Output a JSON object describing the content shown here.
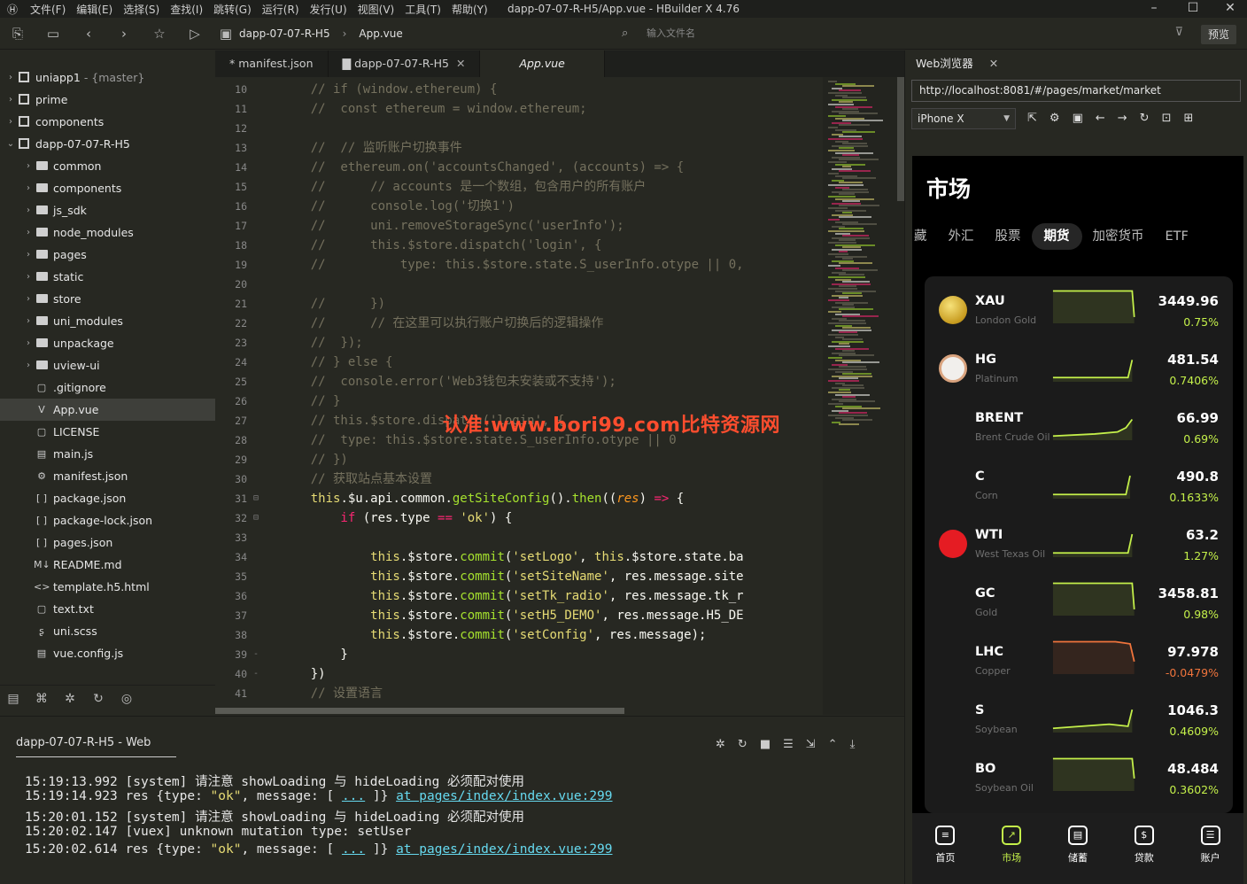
{
  "window": {
    "title": "dapp-07-07-R-H5/App.vue - HBuilder X 4.76",
    "menus": [
      "文件(F)",
      "编辑(E)",
      "选择(S)",
      "查找(I)",
      "跳转(G)",
      "运行(R)",
      "发行(U)",
      "视图(V)",
      "工具(T)",
      "帮助(Y)"
    ]
  },
  "toolbar": {
    "breadcrumb": [
      "dapp-07-07-R-H5",
      "App.vue"
    ],
    "file_input_placeholder": "输入文件名",
    "preview_label": "预览"
  },
  "sidebar": {
    "items": [
      {
        "label": "uniapp1",
        "extra": "- {master}",
        "type": "project",
        "level": 0,
        "chev": "›"
      },
      {
        "label": "prime",
        "extra": "",
        "type": "project",
        "level": 0,
        "chev": "›"
      },
      {
        "label": "components",
        "extra": "",
        "type": "project",
        "level": 0,
        "chev": "›"
      },
      {
        "label": "dapp-07-07-R-H5",
        "extra": "",
        "type": "project",
        "level": 0,
        "chev": "⌄"
      },
      {
        "label": "common",
        "extra": "",
        "type": "folder",
        "level": 1,
        "chev": "›"
      },
      {
        "label": "components",
        "extra": "",
        "type": "folder",
        "level": 1,
        "chev": "›"
      },
      {
        "label": "js_sdk",
        "extra": "",
        "type": "folder",
        "level": 1,
        "chev": "›"
      },
      {
        "label": "node_modules",
        "extra": "",
        "type": "folder",
        "level": 1,
        "chev": "›"
      },
      {
        "label": "pages",
        "extra": "",
        "type": "folder",
        "level": 1,
        "chev": "›"
      },
      {
        "label": "static",
        "extra": "",
        "type": "folder",
        "level": 1,
        "chev": "›"
      },
      {
        "label": "store",
        "extra": "",
        "type": "folder",
        "level": 1,
        "chev": "›"
      },
      {
        "label": "uni_modules",
        "extra": "",
        "type": "folder",
        "level": 1,
        "chev": "›"
      },
      {
        "label": "unpackage",
        "extra": "",
        "type": "folder",
        "level": 1,
        "chev": "›"
      },
      {
        "label": "uview-ui",
        "extra": "",
        "type": "folder",
        "level": 1,
        "chev": "›"
      },
      {
        "label": ".gitignore",
        "extra": "",
        "type": "file",
        "level": 1,
        "chev": "",
        "icon": "▢"
      },
      {
        "label": "App.vue",
        "extra": "",
        "type": "file",
        "level": 1,
        "chev": "",
        "icon": "V",
        "selected": true
      },
      {
        "label": "LICENSE",
        "extra": "",
        "type": "file",
        "level": 1,
        "chev": "",
        "icon": "▢"
      },
      {
        "label": "main.js",
        "extra": "",
        "type": "file",
        "level": 1,
        "chev": "",
        "icon": "▤"
      },
      {
        "label": "manifest.json",
        "extra": "",
        "type": "file",
        "level": 1,
        "chev": "",
        "icon": "⚙"
      },
      {
        "label": "package.json",
        "extra": "",
        "type": "file",
        "level": 1,
        "chev": "",
        "icon": "[ ]"
      },
      {
        "label": "package-lock.json",
        "extra": "",
        "type": "file",
        "level": 1,
        "chev": "",
        "icon": "[ ]"
      },
      {
        "label": "pages.json",
        "extra": "",
        "type": "file",
        "level": 1,
        "chev": "",
        "icon": "[ ]"
      },
      {
        "label": "README.md",
        "extra": "",
        "type": "file",
        "level": 1,
        "chev": "",
        "icon": "M↓"
      },
      {
        "label": "template.h5.html",
        "extra": "",
        "type": "file",
        "level": 1,
        "chev": "",
        "icon": "<>"
      },
      {
        "label": "text.txt",
        "extra": "",
        "type": "file",
        "level": 1,
        "chev": "",
        "icon": "▢"
      },
      {
        "label": "uni.scss",
        "extra": "",
        "type": "file",
        "level": 1,
        "chev": "",
        "icon": "ʂ"
      },
      {
        "label": "vue.config.js",
        "extra": "",
        "type": "file",
        "level": 1,
        "chev": "",
        "icon": "▤"
      }
    ]
  },
  "tabs": [
    {
      "label": "* manifest.json",
      "close": ""
    },
    {
      "label": "dapp-07-07-R-H5",
      "close": "✕"
    },
    {
      "label": "App.vue",
      "close": ""
    }
  ],
  "editor": {
    "lines": [
      {
        "n": 10,
        "fold": "",
        "segs": [
          [
            "cm",
            "    // if (window.ethereum) {"
          ]
        ]
      },
      {
        "n": 11,
        "fold": "",
        "segs": [
          [
            "cm",
            "    //  const ethereum = window.ethereum;"
          ]
        ]
      },
      {
        "n": 12,
        "fold": "",
        "segs": []
      },
      {
        "n": 13,
        "fold": "",
        "segs": [
          [
            "cm",
            "    //  // 监听账户切换事件"
          ]
        ]
      },
      {
        "n": 14,
        "fold": "",
        "segs": [
          [
            "cm",
            "    //  ethereum.on('accountsChanged', (accounts) => {"
          ]
        ]
      },
      {
        "n": 15,
        "fold": "",
        "segs": [
          [
            "cm",
            "    //      // accounts 是一个数组，包含用户的所有账户"
          ]
        ]
      },
      {
        "n": 16,
        "fold": "",
        "segs": [
          [
            "cm",
            "    //      console.log('切换1')"
          ]
        ]
      },
      {
        "n": 17,
        "fold": "",
        "segs": [
          [
            "cm",
            "    //      uni.removeStorageSync('userInfo');"
          ]
        ]
      },
      {
        "n": 18,
        "fold": "",
        "segs": [
          [
            "cm",
            "    //      this.$store.dispatch('login', {"
          ]
        ]
      },
      {
        "n": 19,
        "fold": "",
        "segs": [
          [
            "cm",
            "    //          type: this.$store.state.S_userInfo.otype || 0,"
          ]
        ]
      },
      {
        "n": 20,
        "fold": "",
        "segs": []
      },
      {
        "n": 21,
        "fold": "",
        "segs": [
          [
            "cm",
            "    //      })"
          ]
        ]
      },
      {
        "n": 22,
        "fold": "",
        "segs": [
          [
            "cm",
            "    //      // 在这里可以执行账户切换后的逻辑操作"
          ]
        ]
      },
      {
        "n": 23,
        "fold": "",
        "segs": [
          [
            "cm",
            "    //  });"
          ]
        ]
      },
      {
        "n": 24,
        "fold": "",
        "segs": [
          [
            "cm",
            "    // } else {"
          ]
        ]
      },
      {
        "n": 25,
        "fold": "",
        "segs": [
          [
            "cm",
            "    //  console.error('Web3钱包未安装或不支持');"
          ]
        ]
      },
      {
        "n": 26,
        "fold": "",
        "segs": [
          [
            "cm",
            "    // }"
          ]
        ]
      },
      {
        "n": 27,
        "fold": "",
        "segs": [
          [
            "cm",
            "    // this.$store.dispatch('login', {"
          ]
        ]
      },
      {
        "n": 28,
        "fold": "",
        "segs": [
          [
            "cm",
            "    //  type: this.$store.state.S_userInfo.otype || 0"
          ]
        ]
      },
      {
        "n": 29,
        "fold": "",
        "segs": [
          [
            "cm",
            "    // })"
          ]
        ]
      },
      {
        "n": 30,
        "fold": "",
        "segs": [
          [
            "cm",
            "    // 获取站点基本设置"
          ]
        ]
      },
      {
        "n": 31,
        "fold": "⊟",
        "segs": [
          [
            "this",
            "    this"
          ],
          [
            "pl",
            ".$u.api.common."
          ],
          [
            "fn",
            "getSiteConfig"
          ],
          [
            "pl",
            "()."
          ],
          [
            "fn",
            "then"
          ],
          [
            "pl",
            "(("
          ],
          [
            "it",
            "res"
          ],
          [
            "pl",
            ") "
          ],
          [
            "kw",
            "=>"
          ],
          [
            "pl",
            " {"
          ]
        ]
      },
      {
        "n": 32,
        "fold": "⊟",
        "segs": [
          [
            "kw",
            "        if"
          ],
          [
            "pl",
            " (res.type "
          ],
          [
            "kw",
            "=="
          ],
          [
            "pl",
            " "
          ],
          [
            "str",
            "'ok'"
          ],
          [
            "pl",
            ") {"
          ]
        ]
      },
      {
        "n": 33,
        "fold": "",
        "segs": []
      },
      {
        "n": 34,
        "fold": "",
        "segs": [
          [
            "this",
            "            this"
          ],
          [
            "pl",
            ".$store."
          ],
          [
            "fn",
            "commit"
          ],
          [
            "pl",
            "("
          ],
          [
            "str",
            "'setLogo'"
          ],
          [
            "pl",
            ", "
          ],
          [
            "this",
            "this"
          ],
          [
            "pl",
            ".$store.state.ba"
          ]
        ]
      },
      {
        "n": 35,
        "fold": "",
        "segs": [
          [
            "this",
            "            this"
          ],
          [
            "pl",
            ".$store."
          ],
          [
            "fn",
            "commit"
          ],
          [
            "pl",
            "("
          ],
          [
            "str",
            "'setSiteName'"
          ],
          [
            "pl",
            ", res.message.site"
          ]
        ]
      },
      {
        "n": 36,
        "fold": "",
        "segs": [
          [
            "this",
            "            this"
          ],
          [
            "pl",
            ".$store."
          ],
          [
            "fn",
            "commit"
          ],
          [
            "pl",
            "("
          ],
          [
            "str",
            "'setTk_radio'"
          ],
          [
            "pl",
            ", res.message.tk_r"
          ]
        ]
      },
      {
        "n": 37,
        "fold": "",
        "segs": [
          [
            "this",
            "            this"
          ],
          [
            "pl",
            ".$store."
          ],
          [
            "fn",
            "commit"
          ],
          [
            "pl",
            "("
          ],
          [
            "str",
            "'setH5_DEMO'"
          ],
          [
            "pl",
            ", res.message.H5_DE"
          ]
        ]
      },
      {
        "n": 38,
        "fold": "",
        "segs": [
          [
            "this",
            "            this"
          ],
          [
            "pl",
            ".$store."
          ],
          [
            "fn",
            "commit"
          ],
          [
            "pl",
            "("
          ],
          [
            "str",
            "'setConfig'"
          ],
          [
            "pl",
            ", res.message);"
          ]
        ]
      },
      {
        "n": 39,
        "fold": "-",
        "segs": [
          [
            "pl",
            "        }"
          ]
        ]
      },
      {
        "n": 40,
        "fold": "-",
        "segs": [
          [
            "pl",
            "    })"
          ]
        ]
      },
      {
        "n": 41,
        "fold": "",
        "segs": [
          [
            "cm",
            "    // 设置语言"
          ]
        ]
      }
    ]
  },
  "watermark": "认准:www.bori99.com比特资源网",
  "console": {
    "tab": "dapp-07-07-R-H5 - Web",
    "logs": [
      {
        "time": "15:19:13.992",
        "text": "[system] 请注意 showLoading 与 hideLoading 必须配对使用",
        "ok": "",
        "link": ""
      },
      {
        "time": "15:19:14.923",
        "text": "res {type: ",
        "ok": "\"ok\"",
        "mid": ", message: [ ",
        "dots": "...",
        "end": " ]} ",
        "link": "at pages/index/index.vue:299"
      },
      {
        "time": "15:20:01.152",
        "text": "[system] 请注意 showLoading 与 hideLoading 必须配对使用",
        "ok": "",
        "link": ""
      },
      {
        "time": "15:20:02.147",
        "text": "[vuex] unknown mutation type: setUser",
        "ok": "",
        "link": ""
      },
      {
        "time": "15:20:02.614",
        "text": "res {type: ",
        "ok": "\"ok\"",
        "mid": ", message: [ ",
        "dots": "...",
        "end": " ]} ",
        "link": "at pages/index/index.vue:299"
      }
    ]
  },
  "browser": {
    "tab_label": "Web浏览器",
    "url": "http://localhost:8081/#/pages/market/market",
    "device": "iPhone X",
    "page_title": "市场",
    "categories": [
      "藏",
      "外汇",
      "股票",
      "期货",
      "加密货币",
      "ETF"
    ],
    "active_category": "期货",
    "markets": [
      {
        "symbol": "XAU",
        "name": "London Gold",
        "price": "3449.96",
        "change": "0.75%",
        "avatar": "gold",
        "up": true
      },
      {
        "symbol": "HG",
        "name": "Platinum",
        "price": "481.54",
        "change": "0.7406%",
        "avatar": "platinum",
        "up": true
      },
      {
        "symbol": "BRENT",
        "name": "Brent Crude Oil",
        "price": "66.99",
        "change": "0.69%",
        "avatar": "none",
        "up": true
      },
      {
        "symbol": "C",
        "name": "Corn",
        "price": "490.8",
        "change": "0.1633%",
        "avatar": "none",
        "up": true
      },
      {
        "symbol": "WTI",
        "name": "West Texas Oil",
        "price": "63.2",
        "change": "1.27%",
        "avatar": "wti",
        "up": true
      },
      {
        "symbol": "GC",
        "name": "Gold",
        "price": "3458.81",
        "change": "0.98%",
        "avatar": "none",
        "up": true
      },
      {
        "symbol": "LHC",
        "name": "Copper",
        "price": "97.978",
        "change": "-0.0479%",
        "avatar": "none",
        "up": false
      },
      {
        "symbol": "S",
        "name": "Soybean",
        "price": "1046.3",
        "change": "0.4609%",
        "avatar": "none",
        "up": true
      },
      {
        "symbol": "BO",
        "name": "Soybean Oil",
        "price": "48.484",
        "change": "0.3602%",
        "avatar": "none",
        "up": true
      }
    ],
    "tabbar": [
      {
        "label": "首页",
        "icon": "home-icon"
      },
      {
        "label": "市场",
        "icon": "chart-icon",
        "active": true
      },
      {
        "label": "储蓄",
        "icon": "savings-icon"
      },
      {
        "label": "贷款",
        "icon": "loan-icon"
      },
      {
        "label": "账户",
        "icon": "account-icon"
      }
    ]
  },
  "colors": {
    "up": "#c4f04a",
    "down": "#f0743c",
    "accent": "#c4f04a"
  }
}
